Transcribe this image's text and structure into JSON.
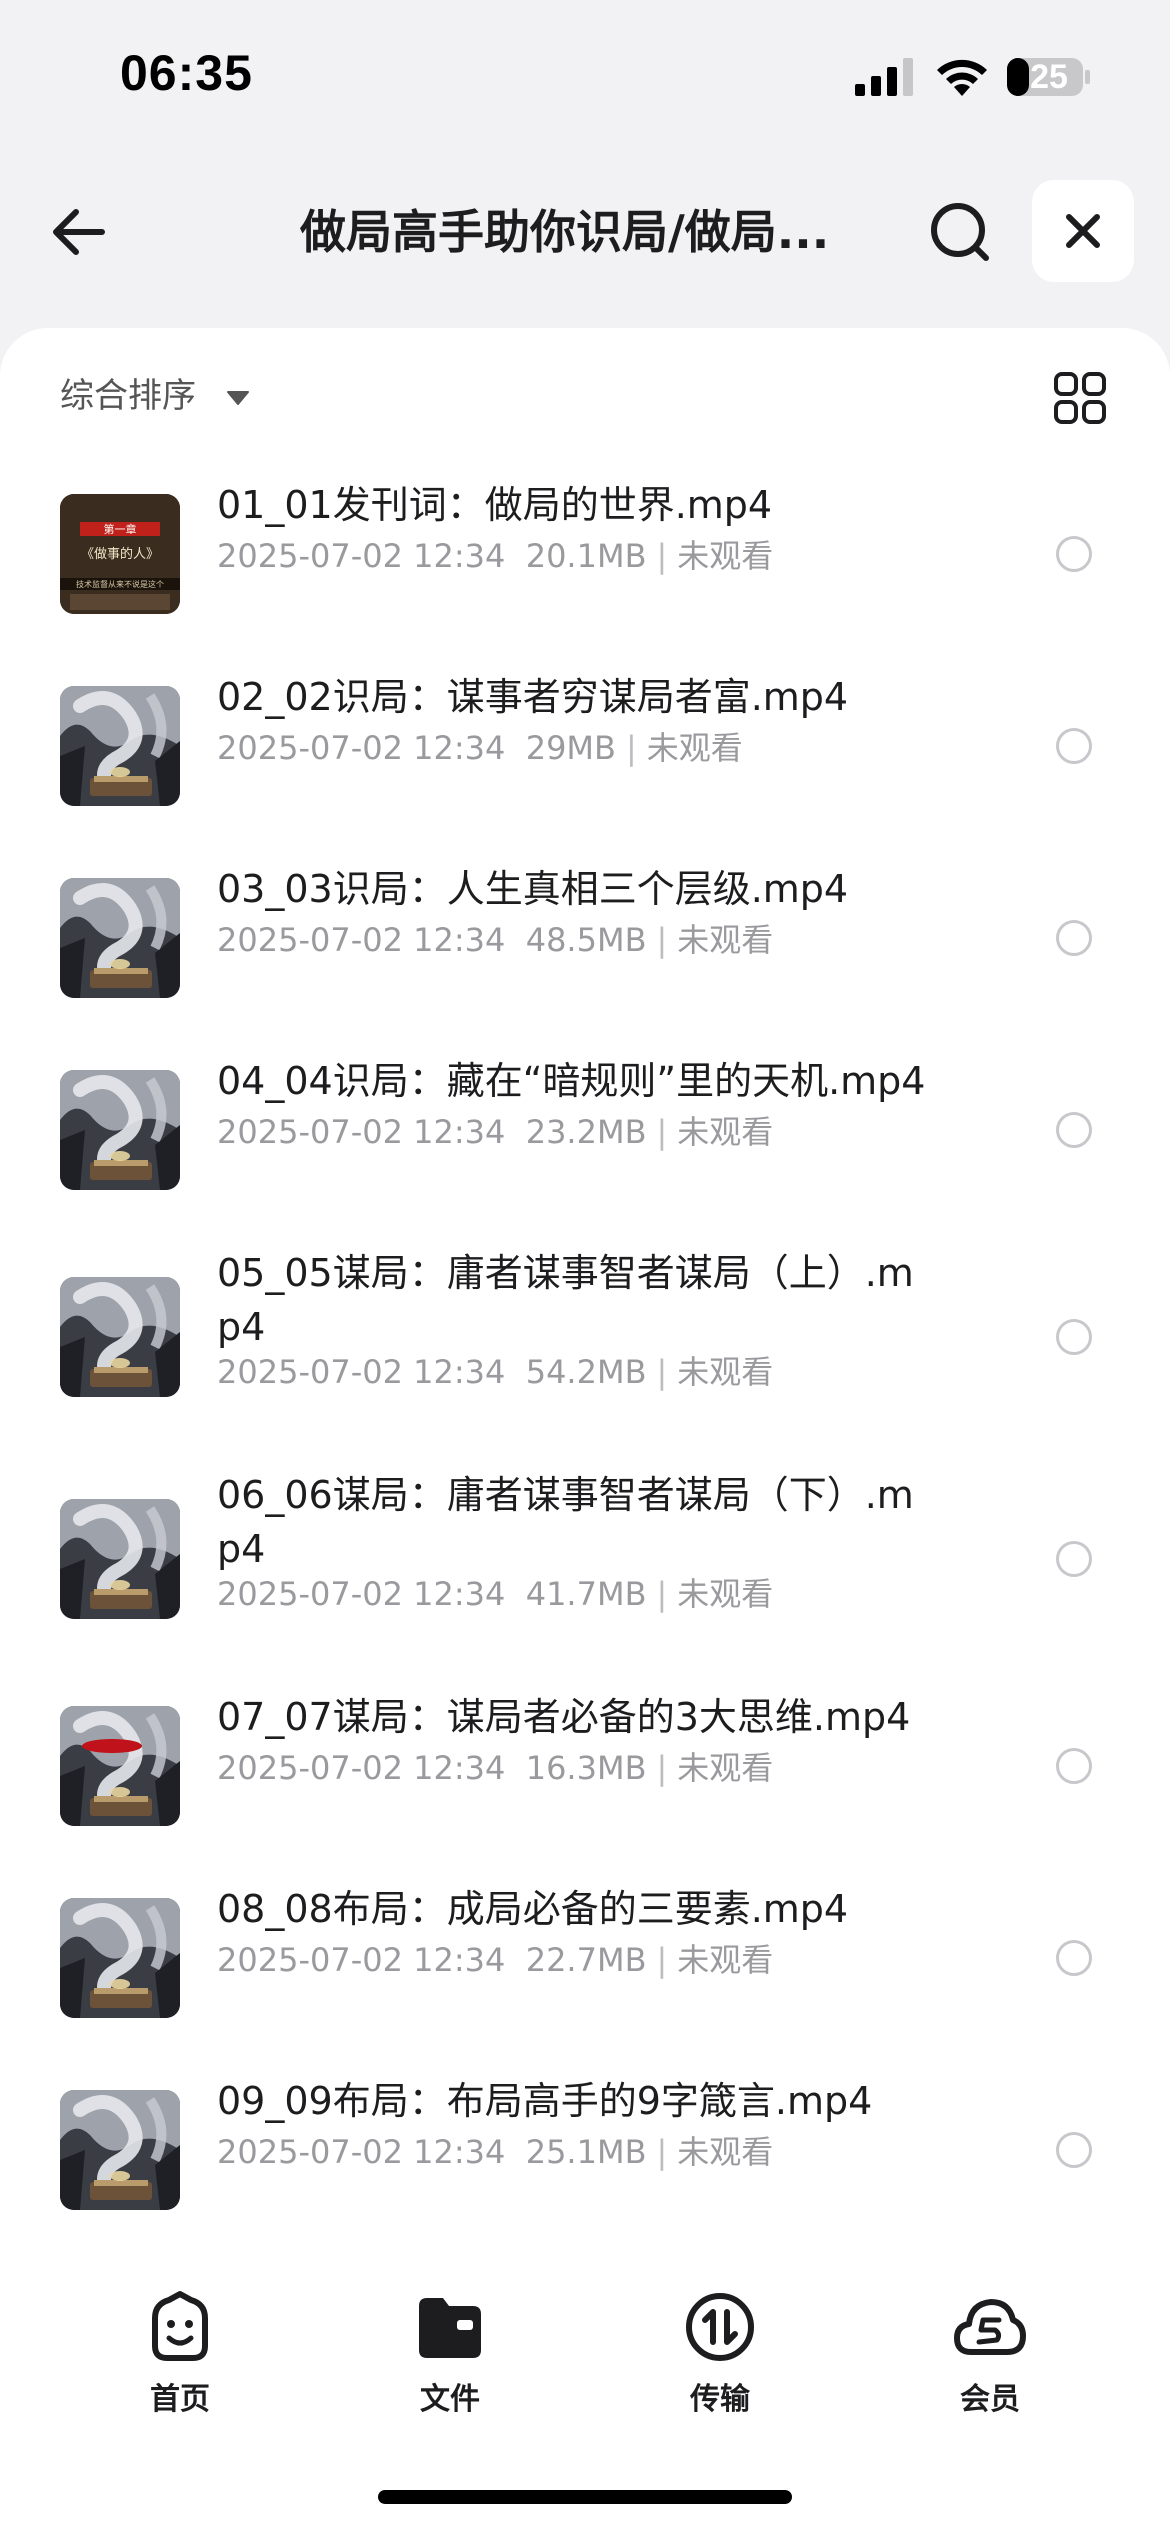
{
  "status_bar": {
    "time": "06:35",
    "battery": "25"
  },
  "header": {
    "title": "做局高手助你识局/做局...",
    "back_icon": "arrow-left-icon",
    "search_icon": "search-icon",
    "close_icon": "close-icon"
  },
  "sort": {
    "label": "综合排序",
    "caret_icon": "caret-down-icon",
    "view_toggle_icon": "grid-view-icon"
  },
  "files": [
    {
      "name": "01_01发刊词：做局的世界.mp4",
      "date": "2025-07-02 12:34",
      "size": "20.1MB",
      "status": "未观看",
      "thumb": "cover"
    },
    {
      "name": "02_02识局：谋事者穷谋局者富.mp4",
      "date": "2025-07-02 12:34",
      "size": "29MB",
      "status": "未观看",
      "thumb": "smoke"
    },
    {
      "name": "03_03识局：人生真相三个层级.mp4",
      "date": "2025-07-02 12:34",
      "size": "48.5MB",
      "status": "未观看",
      "thumb": "smoke"
    },
    {
      "name": "04_04识局：藏在“暗规则”里的天机.mp4",
      "date": "2025-07-02 12:34",
      "size": "23.2MB",
      "status": "未观看",
      "thumb": "smoke"
    },
    {
      "name": "05_05谋局：庸者谋事智者谋局（上）.mp4",
      "date": "2025-07-02 12:34",
      "size": "54.2MB",
      "status": "未观看",
      "thumb": "smoke"
    },
    {
      "name": "06_06谋局：庸者谋事智者谋局（下）.mp4",
      "date": "2025-07-02 12:34",
      "size": "41.7MB",
      "status": "未观看",
      "thumb": "smoke"
    },
    {
      "name": "07_07谋局：谋局者必备的3大思维.mp4",
      "date": "2025-07-02 12:34",
      "size": "16.3MB",
      "status": "未观看",
      "thumb": "smoke-red"
    },
    {
      "name": "08_08布局：成局必备的三要素.mp4",
      "date": "2025-07-02 12:34",
      "size": "22.7MB",
      "status": "未观看",
      "thumb": "smoke"
    },
    {
      "name": "09_09布局：布局高手的9字箴言.mp4",
      "date": "2025-07-02 12:34",
      "size": "25.1MB",
      "status": "未观看",
      "thumb": "smoke"
    }
  ],
  "thumb_cover_text": {
    "top": "第一章",
    "middle": "《做事的人》",
    "bottom": "技术监督从来不说是这个"
  },
  "tabs": [
    {
      "label": "首页",
      "icon": "smile-face-icon"
    },
    {
      "label": "文件",
      "icon": "folder-icon"
    },
    {
      "label": "传输",
      "icon": "transfer-icon"
    },
    {
      "label": "会员",
      "icon": "cloud-vip-icon"
    }
  ]
}
